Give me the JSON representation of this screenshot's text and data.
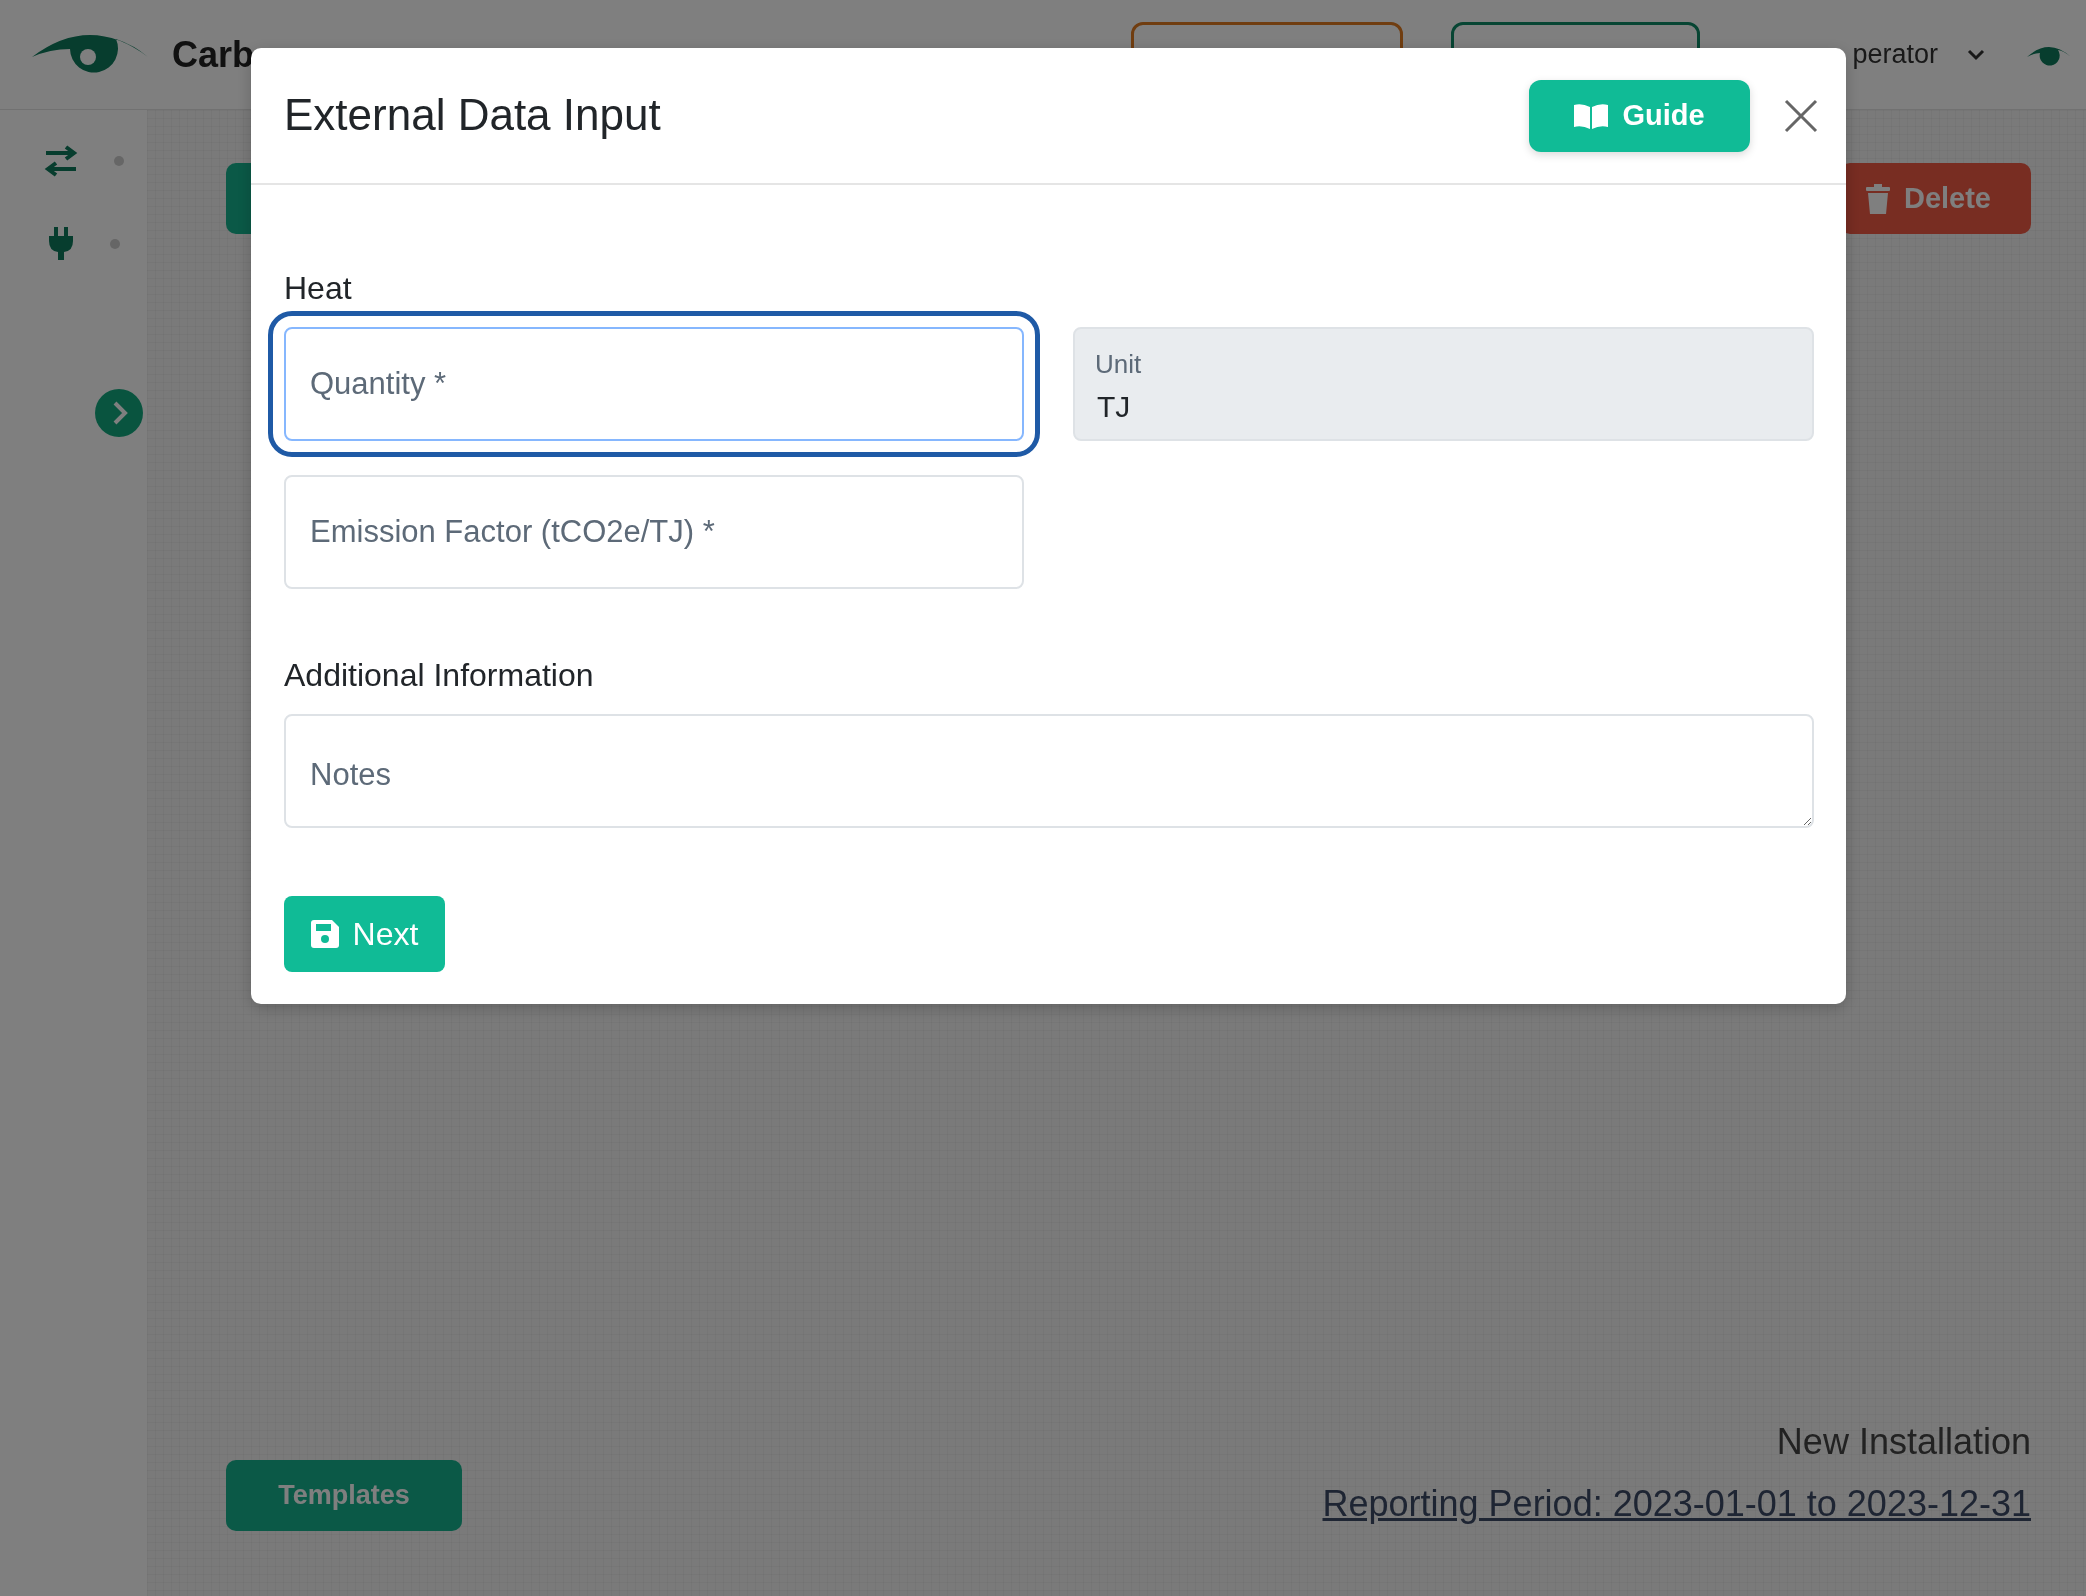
{
  "top_bar": {
    "brand": "Carb",
    "user": "perator"
  },
  "page": {
    "delete_button": "Delete",
    "templates_button": "Templates",
    "installation": "New Installation",
    "reporting_period": "Reporting Period: 2023-01-01 to 2023-12-31"
  },
  "modal": {
    "title": "External Data Input",
    "guide_button": "Guide",
    "sections": [
      {
        "heading": "Heat",
        "fields": [
          {
            "kind": "input",
            "placeholder": "Quantity *",
            "focused": true
          },
          {
            "kind": "readonly",
            "label": "Unit",
            "value": "TJ",
            "focused": false
          },
          {
            "kind": "input",
            "placeholder": "Emission Factor (tCO2e/TJ) *",
            "focused": false
          }
        ]
      },
      {
        "heading": "Additional Information",
        "fields": [
          {
            "kind": "textarea",
            "placeholder": "Notes",
            "focused": false
          }
        ]
      }
    ],
    "next_button": "Next"
  }
}
